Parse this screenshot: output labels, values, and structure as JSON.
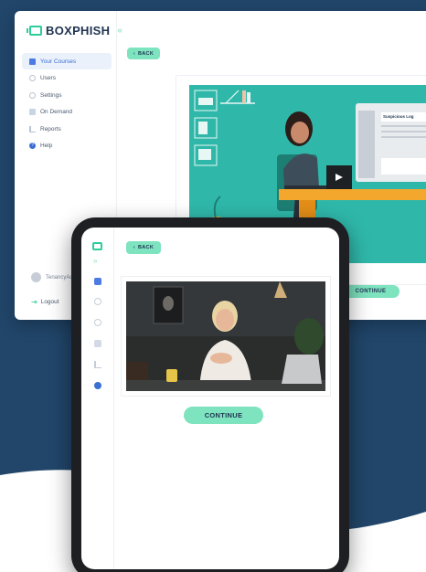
{
  "brand": {
    "name": "BOXPHISH",
    "collapse_glyph": "«"
  },
  "sidebar": {
    "items": [
      {
        "label": "Your Courses",
        "icon": "book-icon",
        "active": true
      },
      {
        "label": "Users",
        "icon": "users-icon"
      },
      {
        "label": "Settings",
        "icon": "settings-icon"
      },
      {
        "label": "On Demand",
        "icon": "on-demand-icon"
      },
      {
        "label": "Reports",
        "icon": "reports-icon"
      },
      {
        "label": "Help",
        "icon": "help-icon"
      }
    ],
    "user_name": "TenancyAd",
    "logout_label": "Logout"
  },
  "course": {
    "back_label": "BACK",
    "continue_label": "CONTINUE",
    "laptop_screen_heading": "Suspicious Log"
  },
  "tablet": {
    "expand_glyph": "»",
    "back_label": "BACK",
    "continue_label": "CONTINUE"
  },
  "colors": {
    "accent": "#7ee3bf",
    "brand_green": "#2ecc9a",
    "navy": "#21466a",
    "active_blue": "#3b6fd4"
  }
}
